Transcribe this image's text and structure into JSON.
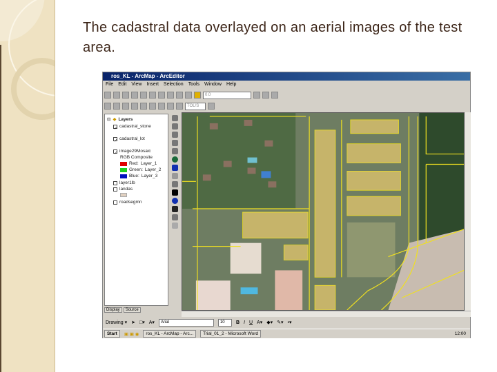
{
  "slide": {
    "title": "The cadastral data overlayed on an aerial images of the test area."
  },
  "window": {
    "title": "ros_KL - ArcMap - ArcEditor",
    "menu": [
      "File",
      "Edit",
      "View",
      "Insert",
      "Selection",
      "Tools",
      "Window",
      "Help"
    ],
    "scale_value": "0.0",
    "font_size_dd": "TOL/S"
  },
  "toc": {
    "root": "Layers",
    "layers": [
      {
        "name": "cadastral_stone",
        "checked": true
      },
      {
        "name": "cadastral_lot",
        "checked": true
      },
      {
        "name": "image29Mosaic",
        "checked": true,
        "renderer": "RGB Composite",
        "bands": [
          {
            "label": "Red:",
            "band": "Layer_1",
            "color": "#e00000"
          },
          {
            "label": "Green:",
            "band": "Layer_2",
            "color": "#20d020"
          },
          {
            "label": "Blue:",
            "band": "Layer_3",
            "color": "#0010c0"
          }
        ]
      },
      {
        "name": "layer1lb",
        "checked": false
      },
      {
        "name": "landas",
        "checked": false
      },
      {
        "name": "roadsegmn",
        "checked": false
      }
    ],
    "tabs": [
      "Display",
      "Source"
    ]
  },
  "drawing_toolbar": {
    "drawing": "Drawing ▾",
    "font": "Arial",
    "size": "10",
    "bold": "B",
    "italic": "I",
    "underline": "U"
  },
  "taskbar": {
    "start": "Start",
    "tasks": [
      "ros_KL - ArcMap - Arc...",
      "Trial_01_2 - Microsoft Word"
    ],
    "clock": "12:00"
  },
  "colors": {
    "parcel_line": "#f0e020",
    "title_bar": "#0a246a"
  }
}
